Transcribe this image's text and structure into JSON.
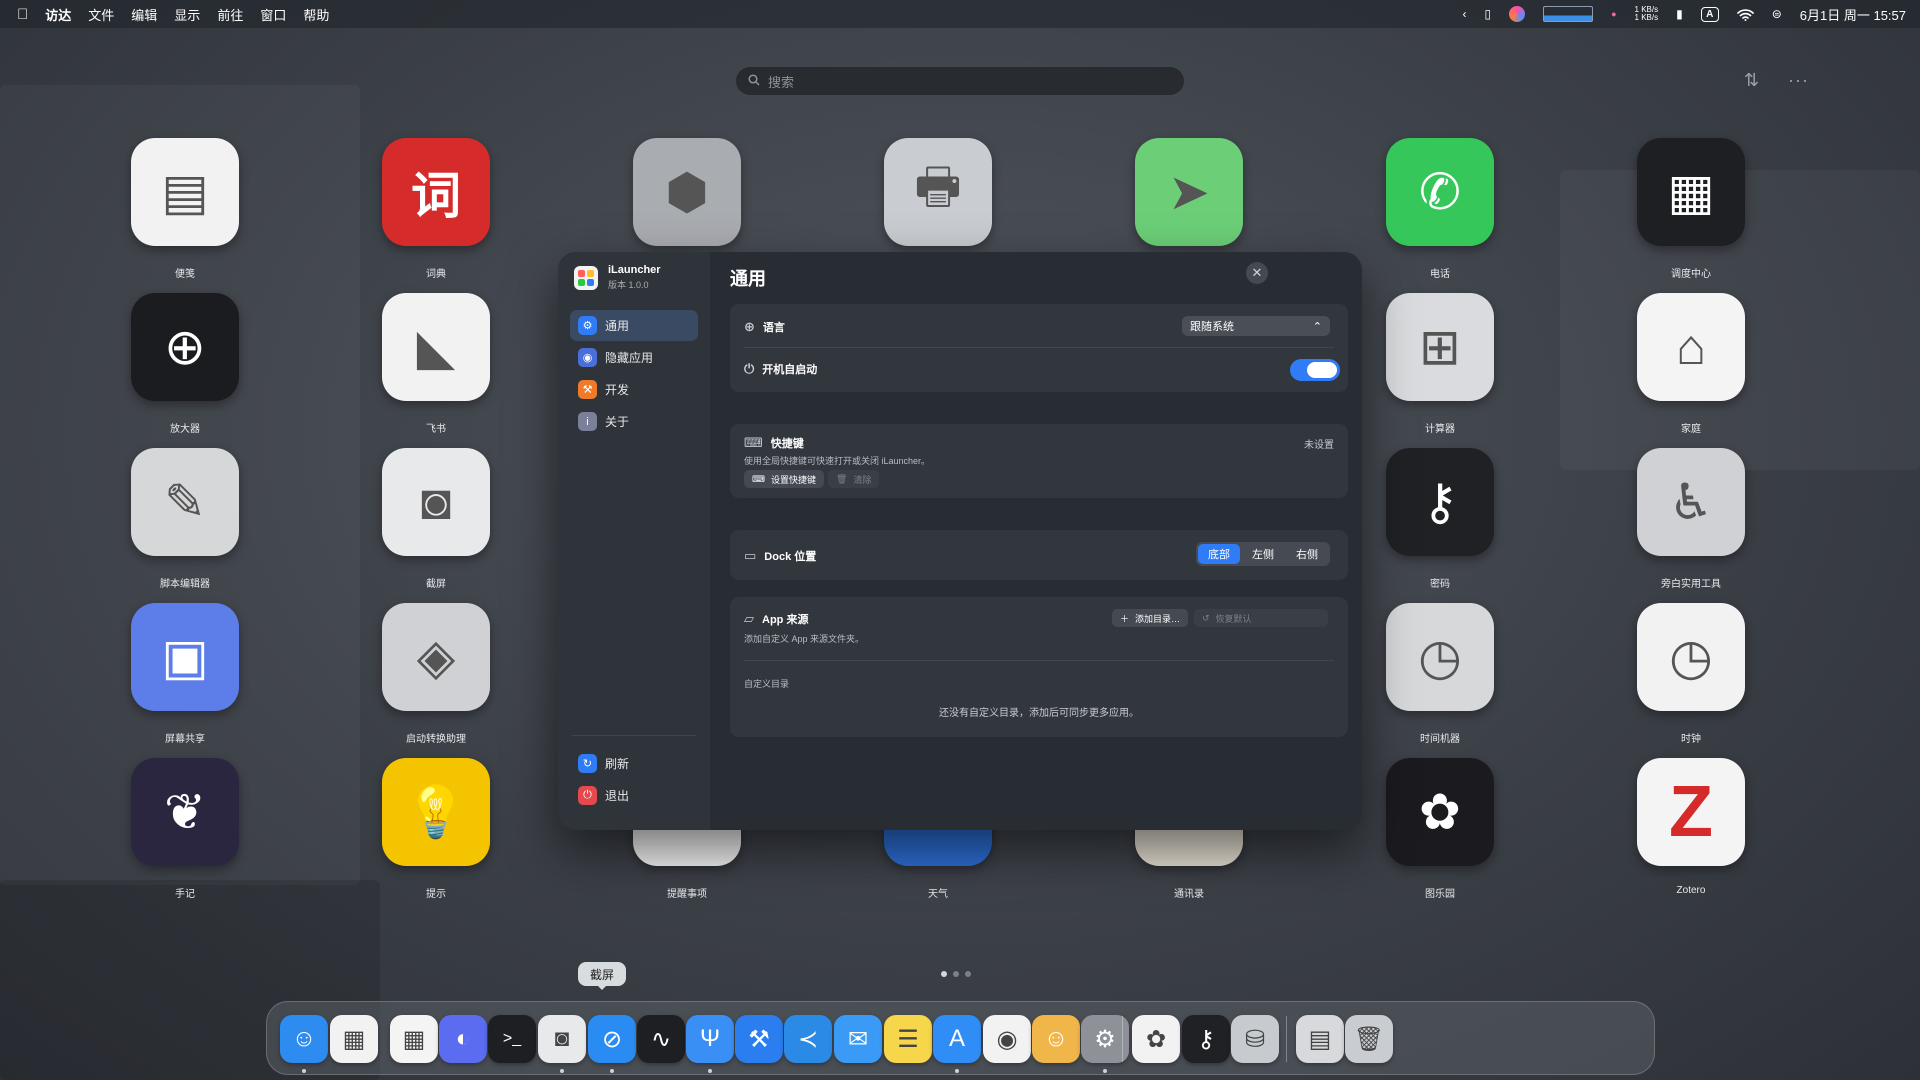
{
  "menubar": {
    "apple_icon": "apple-logo",
    "items": [
      "访达",
      "文件",
      "编辑",
      "显示",
      "前往",
      "窗口",
      "帮助"
    ],
    "net_up": "1 KB/s",
    "net_down": "1 KB/s",
    "input_method": "A",
    "datetime": "6月1日 周一 15:57"
  },
  "search": {
    "placeholder": "搜索"
  },
  "apps": [
    {
      "label": "便笺",
      "icon": "stickies-icon",
      "color": "#f2f2f2"
    },
    {
      "label": "词典",
      "icon": "dictionary-icon",
      "color": "#d52b2b",
      "glyph": "词"
    },
    {
      "label": "",
      "icon": "system-utility-icon",
      "color": "#a9acb1"
    },
    {
      "label": "",
      "icon": "printer-icon",
      "color": "#c9ccd0"
    },
    {
      "label": "",
      "icon": "maps-icon",
      "color": "#6ccf78"
    },
    {
      "label": "电话",
      "icon": "phone-icon",
      "color": "#35c759"
    },
    {
      "label": "调度中心",
      "icon": "mission-control-icon",
      "color": "#1d1f22"
    },
    {
      "label": "放大器",
      "icon": "magnifier-icon",
      "color": "#1b1c1f"
    },
    {
      "label": "飞书",
      "icon": "feishu-icon",
      "color": "#f2f2f2"
    },
    {
      "label": "计算器",
      "icon": "calculator-icon",
      "color": "#d9dbde"
    },
    {
      "label": "家庭",
      "icon": "home-icon",
      "color": "#f4f4f4"
    },
    {
      "label": "脚本编辑器",
      "icon": "script-editor-icon",
      "color": "#d6d7d9"
    },
    {
      "label": "截屏",
      "icon": "screenshot-icon",
      "color": "#e8e9eb"
    },
    {
      "label": "密码",
      "icon": "passwords-icon",
      "color": "#1f2124"
    },
    {
      "label": "旁白实用工具",
      "icon": "voiceover-utility-icon",
      "color": "#cfd1d4"
    },
    {
      "label": "屏幕共享",
      "icon": "screen-sharing-icon",
      "color": "#5d7ee8"
    },
    {
      "label": "启动转换助理",
      "icon": "boot-camp-icon",
      "color": "#cfd1d4"
    },
    {
      "label": "时间机器",
      "icon": "time-machine-icon",
      "color": "#d6d8da"
    },
    {
      "label": "时钟",
      "icon": "clock-icon",
      "color": "#f2f2f2"
    },
    {
      "label": "手记",
      "icon": "journal-icon",
      "color": "#2a2640"
    },
    {
      "label": "提示",
      "icon": "tips-icon",
      "color": "#f5c400"
    },
    {
      "label": "提醒事项",
      "icon": "reminders-icon",
      "color": "#f4f4f4"
    },
    {
      "label": "天气",
      "icon": "weather-icon",
      "color": "#2d6fd6"
    },
    {
      "label": "通讯录",
      "icon": "contacts-icon",
      "color": "#e6e0d4"
    },
    {
      "label": "图乐园",
      "icon": "image-playground-icon",
      "color": "#1a1a1f"
    },
    {
      "label": "Zotero",
      "icon": "zotero-icon",
      "color": "#f4f4f4",
      "glyph": "Z"
    }
  ],
  "window": {
    "app_name": "iLauncher",
    "version": "版本 1.0.0",
    "title": "通用",
    "sidebar": [
      {
        "label": "通用",
        "icon": "gear-icon",
        "color": "#2f7cf6"
      },
      {
        "label": "隐藏应用",
        "icon": "eye-icon",
        "color": "#4a6fdc"
      },
      {
        "label": "开发",
        "icon": "hammer-icon",
        "color": "#f07a28"
      },
      {
        "label": "关于",
        "icon": "info-icon",
        "color": "#7a7f9a"
      }
    ],
    "sidebar_bottom": [
      {
        "label": "刷新",
        "icon": "refresh-icon",
        "color": "#2f7cf6"
      },
      {
        "label": "退出",
        "icon": "power-icon",
        "color": "#e5484d"
      }
    ],
    "language": {
      "label": "语言",
      "value": "跟随系统"
    },
    "autostart": {
      "label": "开机自启动",
      "on": true
    },
    "shortcut": {
      "label": "快捷键",
      "status": "未设置",
      "desc": "使用全局快捷键可快速打开或关闭 iLauncher。",
      "set_btn": "设置快捷键",
      "clear_btn": "清除"
    },
    "dock_position": {
      "label": "Dock 位置",
      "options": [
        "底部",
        "左侧",
        "右侧"
      ],
      "selected": "底部"
    },
    "app_source": {
      "label": "App 来源",
      "add_btn": "添加目录…",
      "reset_btn": "恢复默认",
      "desc": "添加自定义 App 来源文件夹。",
      "custom_label": "自定义目录",
      "empty_text": "还没有自定义目录，添加后可同步更多应用。"
    }
  },
  "page_indicator": {
    "pages": 3,
    "current": 1
  },
  "dock": {
    "tooltip": "截屏",
    "items": [
      "finder-icon",
      "launchpad-icon",
      "ilauncher-icon",
      "chatbot-icon",
      "terminal-icon",
      "screenshot-icon",
      "safari-icon",
      "activity-monitor-icon",
      "fork-icon",
      "xcode-icon",
      "vscode-icon",
      "mail-icon",
      "notes-icon",
      "app-store-icon",
      "chrome-icon",
      "bubble-icon",
      "system-settings-icon",
      "photos-icon",
      "passwords-icon",
      "disk-utility-icon",
      "preview-icon",
      "trash-icon"
    ]
  }
}
